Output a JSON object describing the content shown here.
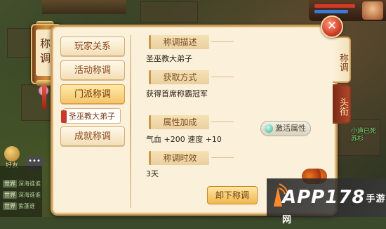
{
  "scroll_title": "称调",
  "menu": {
    "player_relations": "玩家关系",
    "activity_titles": "活动称调",
    "sect_titles": "门派称调",
    "sect_sub_item": "圣巫教大弟子",
    "achievement_titles": "成就称调"
  },
  "sections": {
    "description": {
      "heading": "称调描述",
      "value": "圣巫教大弟子"
    },
    "obtain": {
      "heading": "获取方式",
      "value": "获得首席称霸冠军"
    },
    "attributes": {
      "heading": "属性加成",
      "value": "气血 +200  速度 +10"
    },
    "duration": {
      "heading": "称调时效",
      "value": "3天"
    }
  },
  "buttons": {
    "activate_attr": "激活属性",
    "remove_title": "卸下称调"
  },
  "tabs": {
    "titles_tab": "称调",
    "rank_tab": "头衔"
  },
  "hud": {
    "friends_label": "好友",
    "chat_tag": "世界",
    "chat_lines": [
      "深海谁谁",
      "深海谁谁",
      "紫蓬谁"
    ],
    "right_green": [
      "小道已死",
      "苏杉"
    ]
  },
  "watermark": {
    "brand": "APP178",
    "suffix": "手游网"
  }
}
